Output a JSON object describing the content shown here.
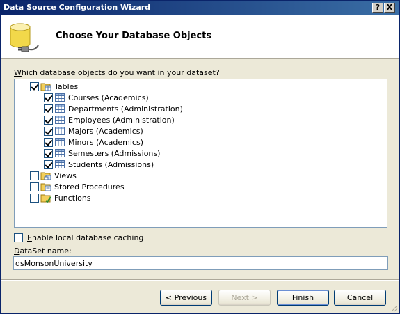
{
  "window": {
    "title": "Data Source Configuration Wizard",
    "help_button": "?",
    "close_button": "X"
  },
  "header": {
    "title": "Choose Your Database Objects",
    "icon": "database-plug-icon"
  },
  "prompt": {
    "prefix": "W",
    "rest": "hich database objects do you want in your dataset?"
  },
  "tree": {
    "tables": {
      "label": "Tables",
      "checked": true,
      "items": [
        {
          "label": "Courses (Academics)",
          "checked": true
        },
        {
          "label": "Departments (Administration)",
          "checked": true
        },
        {
          "label": "Employees (Administration)",
          "checked": true
        },
        {
          "label": "Majors (Academics)",
          "checked": true
        },
        {
          "label": "Minors (Academics)",
          "checked": true
        },
        {
          "label": "Semesters (Admissions)",
          "checked": true
        },
        {
          "label": "Students (Admissions)",
          "checked": true
        }
      ]
    },
    "views": {
      "label": "Views",
      "checked": false
    },
    "stored_procedures": {
      "label": "Stored Procedures",
      "checked": false
    },
    "functions": {
      "label": "Functions",
      "checked": false
    }
  },
  "cache": {
    "prefix": "E",
    "rest": "nable local database caching",
    "checked": false
  },
  "dataset": {
    "prefix": "D",
    "rest": "ataSet name:",
    "value": "dsMonsonUniversity"
  },
  "buttons": {
    "previous": {
      "lt": "< ",
      "accel": "P",
      "rest": "revious"
    },
    "next": "Next >",
    "finish": {
      "accel": "F",
      "rest": "inish"
    },
    "cancel": "Cancel"
  },
  "colors": {
    "title_start": "#0a246a",
    "title_end": "#3a6ea5",
    "dialog_bg": "#ece9d8"
  }
}
